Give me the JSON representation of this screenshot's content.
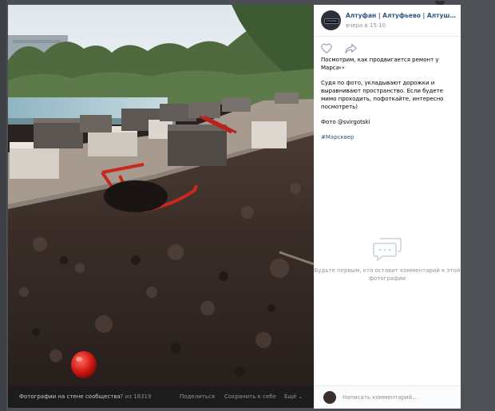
{
  "post": {
    "community_name": "Алтуфан | Алтуфьево | Алтушка, пр...",
    "time": "вчера в 15:10",
    "paragraphs": [
      "Посмотрим, как продвигается ремонт у Марса👀",
      "Судя по фото, укладывают дорожки и выравнивают пространство. Если будете мимо проходить, пофоткайте, интересно посмотреть)",
      "Фото @svirgotski"
    ],
    "hashtag": "#Марсквер",
    "avatar_caption": "Алтуфан"
  },
  "comments": {
    "empty_text": "Будьте первым, кто оставит комментарий к этой фотографии",
    "placeholder": "Написать комментарий..."
  },
  "photo_bar": {
    "album": "Фотографии на стене сообщества",
    "counter": "7 из 18319",
    "share": "Поделиться",
    "save": "Сохранить к себе",
    "more": "Ещё ⌄"
  },
  "colors": {
    "link": "#2a5885",
    "muted": "#939393",
    "backdrop": "#4b4e52",
    "photo_bar": "#1c1c1c"
  },
  "icons": [
    "heart-icon",
    "share-arrow-icon",
    "chat-bubbles-icon"
  ]
}
